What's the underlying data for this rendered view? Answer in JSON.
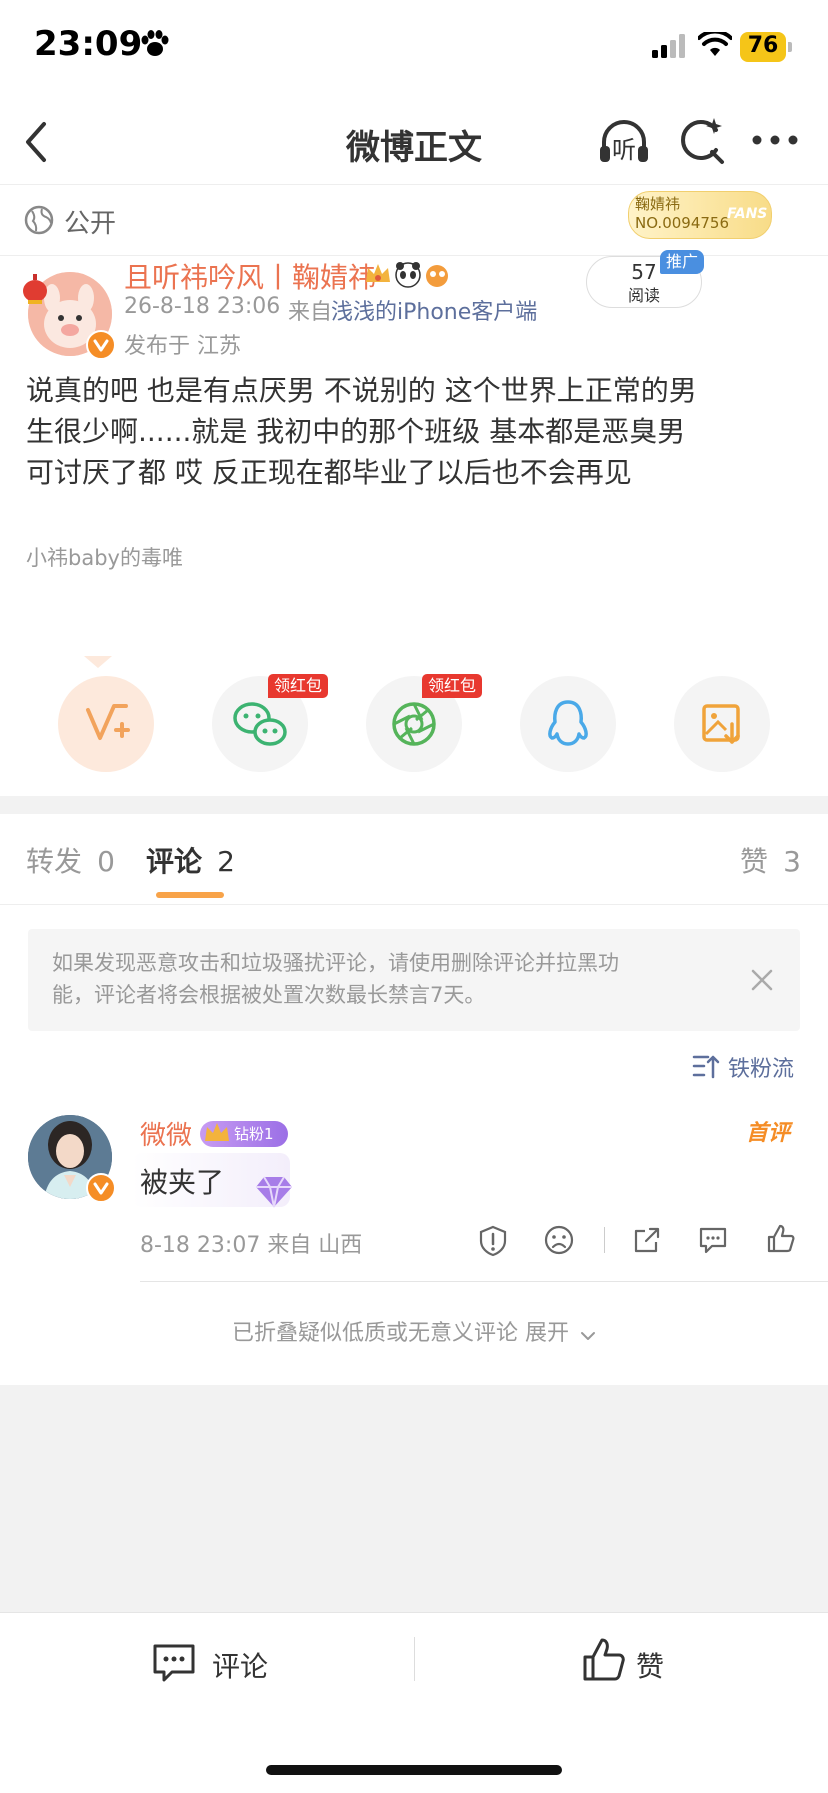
{
  "status": {
    "time": "23:09",
    "battery": "76"
  },
  "nav": {
    "title": "微博正文",
    "listen": "听"
  },
  "visibility": {
    "label": "公开",
    "fan_badge_name": "鞠婧祎",
    "fan_badge_no": "NO.0094756",
    "fan_badge_tag": "FANS"
  },
  "post": {
    "author": "且听祎吟风丨鞠婧祎",
    "date": "26-8-18 23:06",
    "source_prefix": "来自",
    "source": "浅浅的iPhone客户端",
    "location": "发布于 江苏",
    "reads_count": "57",
    "reads_label": "阅读",
    "promo": "推广",
    "content_lines": [
      "说真的吧 也是有点厌男 不说别的 这个世界上正常的男",
      "生很少啊......就是 我初中的那个班级 基本都是恶臭男",
      "可讨厌了都 哎 反正现在都毕业了以后也不会再见"
    ],
    "topic_label": "小祎baby的毒唯"
  },
  "share": {
    "items": [
      "weibo-forward",
      "wechat",
      "moments",
      "qq",
      "save-image"
    ],
    "red_packet": "领红包"
  },
  "tabs": {
    "repost": {
      "label": "转发",
      "count": "0"
    },
    "comment": {
      "label": "评论",
      "count": "2"
    },
    "like": {
      "label": "赞",
      "count": "3"
    }
  },
  "notice": {
    "line1": "如果发现恶意攻击和垃圾骚扰评论，请使用删除评论并拉黑功",
    "line2": "能，评论者将会根据被处置次数最长禁言7天。"
  },
  "sort": {
    "label": "铁粉流"
  },
  "comment": {
    "author": "微微",
    "fan_badge": "钻粉1",
    "first_label": "首评",
    "text": "被夹了",
    "meta": "8-18 23:07 来自 山西"
  },
  "folded": {
    "label": "已折叠疑似低质或无意义评论 展开"
  },
  "bottom": {
    "comment_label": "评论",
    "like_label": "赞"
  },
  "colors": {
    "accent_orange": "#eb7350",
    "link_blue": "#5d6f9c",
    "red_tag": "#e8382f",
    "tab_indicator": "#f8a349"
  }
}
